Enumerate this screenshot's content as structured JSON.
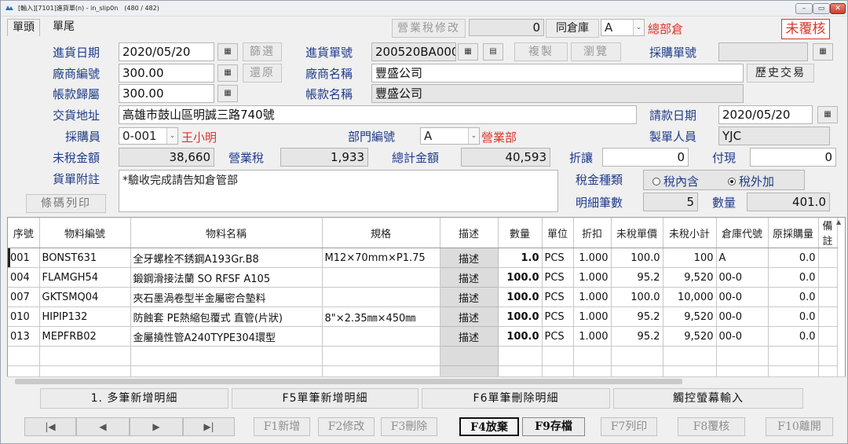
{
  "window": {
    "title": "[輸入][7101]進貨單(n) - in_slip0n　(480 / 482)"
  },
  "tabs": [
    "單頭",
    "單尾"
  ],
  "top": {
    "tax_edit_label": "營業稅修改",
    "tax_edit_value": "0",
    "same_warehouse_label": "同倉庫",
    "warehouse_code": "A",
    "warehouse_name": "總部倉",
    "status": "未覆核"
  },
  "header": {
    "purchase_date_label": "進貨日期",
    "purchase_date": "2020/05/20",
    "filter_btn": "篩選",
    "restore_btn": "還原",
    "purchase_no_label": "進貨單號",
    "purchase_no": "200520BA000",
    "copy_btn": "複製",
    "browse_btn": "瀏覽",
    "purchase_order_label": "採購單號",
    "vendor_code_label": "廠商編號",
    "vendor_code": "300.00",
    "vendor_name_label": "廠商名稱",
    "vendor_name": "豐盛公司",
    "history_btn": "歷史交易",
    "account_code_label": "帳款歸屬",
    "account_code": "300.00",
    "account_name_label": "帳款名稱",
    "account_name": "豐盛公司",
    "delivery_addr_label": "交貨地址",
    "delivery_addr": "高雄市鼓山區明誠三路740號",
    "bill_date_label": "請款日期",
    "bill_date": "2020/05/20",
    "buyer_label": "採購員",
    "buyer_code": "0-001",
    "buyer_name": "王小明",
    "dept_label": "部門編號",
    "dept_code": "A",
    "dept_name": "營業部",
    "creator_label": "製單人員",
    "creator": "YJC",
    "untaxed_label": "未稅金額",
    "untaxed": "38,660",
    "tax_label": "營業稅",
    "tax": "1,933",
    "total_label": "總計金額",
    "total": "40,593",
    "discount_label": "折讓",
    "discount": "0",
    "cash_label": "付現",
    "cash": "0",
    "note_label": "貨單附註",
    "note": "*驗收完成請告知倉管部",
    "tax_type_label": "稅金種類",
    "tax_incl": "稅內含",
    "tax_excl": "稅外加",
    "detail_count_label": "明細筆數",
    "detail_count": "5",
    "qty_label": "數量",
    "qty": "401.0",
    "barcode_btn": "條碼列印"
  },
  "table": {
    "columns": [
      "序號",
      "物料編號",
      "物料名稱",
      "規格",
      "描述",
      "數量",
      "單位",
      "折扣",
      "未稅單價",
      "未稅小計",
      "倉庫代號",
      "原採購量",
      "備註"
    ],
    "rows": [
      {
        "seq": "001",
        "code": "BONST631",
        "name": "全牙螺栓不銹鋼A193Gr.B8",
        "spec": "M12×70mm×P1.75",
        "desc": "描述",
        "qty": "1.0",
        "unit": "PCS",
        "disc": "1.000",
        "price": "100.0",
        "subtotal": "100",
        "wh": "A",
        "orig": "0.0"
      },
      {
        "seq": "004",
        "code": "FLAMGH54",
        "name": "鍛鋼滑接法蘭 SO RFSF A105",
        "spec": "",
        "desc": "描述",
        "qty": "100.0",
        "unit": "PCS",
        "disc": "1.000",
        "price": "95.2",
        "subtotal": "9,520",
        "wh": "00-0",
        "orig": "0.0"
      },
      {
        "seq": "007",
        "code": "GKTSMQ04",
        "name": "夾石墨渦卷型半金屬密合墊料",
        "spec": "",
        "desc": "描述",
        "qty": "100.0",
        "unit": "PCS",
        "disc": "1.000",
        "price": "100.0",
        "subtotal": "10,000",
        "wh": "00-0",
        "orig": "0.0"
      },
      {
        "seq": "010",
        "code": "HIPIP132",
        "name": "防蝕套 PE熱縮包覆式 直管(片狀)",
        "spec": "8\"×2.35㎜×450㎜",
        "desc": "描述",
        "qty": "100.0",
        "unit": "PCS",
        "disc": "1.000",
        "price": "95.2",
        "subtotal": "9,520",
        "wh": "00-0",
        "orig": "0.0"
      },
      {
        "seq": "013",
        "code": "MEPFRB02",
        "name": "金屬撓性管A240TYPE304環型",
        "spec": "",
        "desc": "描述",
        "qty": "100.0",
        "unit": "PCS",
        "disc": "1.000",
        "price": "95.2",
        "subtotal": "9,520",
        "wh": "00-0",
        "orig": "0.0"
      }
    ]
  },
  "bottom": {
    "multi_add": "1. 多筆新增明細",
    "f5_add": "F5單筆新增明細",
    "f6_delete": "F6單筆刪除明細",
    "touch_input": "觸控螢幕輸入"
  },
  "nav": [
    "|◀",
    "◀",
    "▶",
    "▶|"
  ],
  "fkeys": [
    "F1新增",
    "F2修改",
    "F3刪除",
    "F4放棄",
    "F9存檔",
    "F7列印",
    "F8覆核",
    "F10離開"
  ]
}
